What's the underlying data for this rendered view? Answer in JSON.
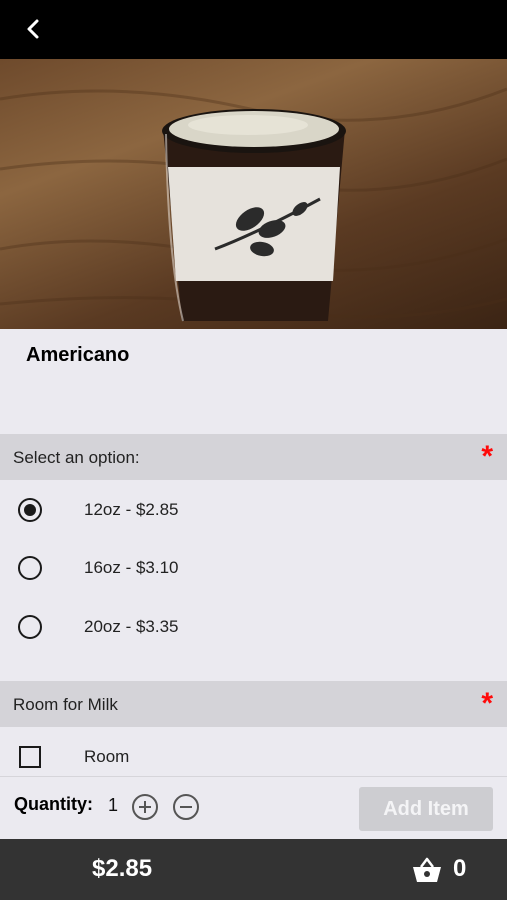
{
  "header": {
    "back_icon": "chevron-left-icon"
  },
  "product": {
    "title": "Americano",
    "image_alt": "Americano in glass with coffee sleeve"
  },
  "size_section": {
    "title": "Select an option:",
    "required_mark": "*",
    "options": [
      {
        "label": "12oz - $2.85",
        "selected": true
      },
      {
        "label": "16oz - $3.10",
        "selected": false
      },
      {
        "label": "20oz - $3.35",
        "selected": false
      }
    ]
  },
  "milk_section": {
    "title": "Room for Milk",
    "required_mark": "*",
    "options": [
      {
        "label": "Room",
        "checked": false
      }
    ]
  },
  "quantity": {
    "label": "Quantity:",
    "value": "1",
    "plus_icon": "plus-circle-icon",
    "minus_icon": "minus-circle-icon"
  },
  "add_button": {
    "label": "Add Item",
    "disabled": true
  },
  "footer": {
    "total": "$2.85",
    "cart_icon": "basket-icon",
    "cart_count": "0"
  },
  "colors": {
    "required": "#ff0a0a",
    "footer_bg": "#333333",
    "header_bg": "#000000",
    "section_bg": "#d4d3d8"
  }
}
